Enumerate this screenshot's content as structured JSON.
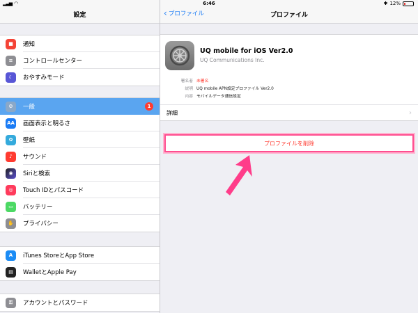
{
  "status": {
    "left": "all",
    "time": "6:46",
    "battery": "12%"
  },
  "left": {
    "title": "設定",
    "groups": [
      [
        {
          "label": "通知",
          "icon": "notifications-icon",
          "color": "#f44336"
        },
        {
          "label": "コントロールセンター",
          "icon": "control-center-icon",
          "color": "#8e8e93"
        },
        {
          "label": "おやすみモード",
          "icon": "moon-icon",
          "color": "#5856d6"
        }
      ],
      [
        {
          "label": "一般",
          "icon": "gear-icon",
          "color": "#8e8e93",
          "badge": "1",
          "selected": true
        },
        {
          "label": "画面表示と明るさ",
          "icon": "display-brightness-icon",
          "color": "#1b7cf5"
        },
        {
          "label": "壁紙",
          "icon": "wallpaper-icon",
          "color": "#34aadc"
        },
        {
          "label": "サウンド",
          "icon": "sound-icon",
          "color": "#ff3b30"
        },
        {
          "label": "Siriと検索",
          "icon": "siri-icon",
          "color": "#222222"
        },
        {
          "label": "Touch IDとパスコード",
          "icon": "touch-id-icon",
          "color": "#ff3b5c"
        },
        {
          "label": "バッテリー",
          "icon": "battery-icon",
          "color": "#4cd964"
        },
        {
          "label": "プライバシー",
          "icon": "privacy-hand-icon",
          "color": "#8e8e93"
        }
      ],
      [
        {
          "label": "iTunes StoreとApp Store",
          "icon": "app-store-icon",
          "color": "#1b8cf5"
        },
        {
          "label": "WalletとApple Pay",
          "icon": "wallet-icon",
          "color": "#222222"
        }
      ],
      [
        {
          "label": "アカウントとパスワード",
          "icon": "key-icon",
          "color": "#8e8e93"
        }
      ]
    ]
  },
  "right": {
    "back_label": "プロファイル",
    "title": "プロファイル",
    "profile": {
      "name": "UQ mobile for iOS Ver2.0",
      "org": "UQ Communications Inc.",
      "signer_key": "署名者",
      "signer_value": "未署名",
      "desc_key": "説明",
      "desc_value": "UQ mobile APN設定プロファイル Ver2.0",
      "content_key": "内容",
      "content_value": "モバイルデータ通信設定"
    },
    "detail_label": "詳細",
    "delete_label": "プロファイルを削除"
  },
  "colors": {
    "accent": "#1b7cf5",
    "highlight": "#ff4d8f",
    "destructive": "#ff3b30",
    "selected_row": "#5aa5f0"
  }
}
